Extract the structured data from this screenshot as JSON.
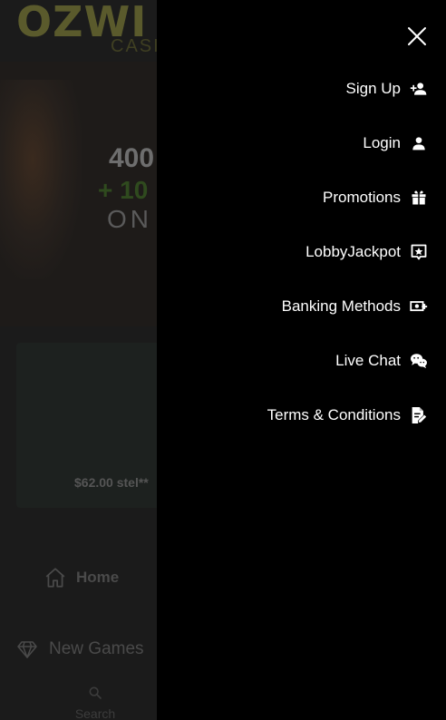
{
  "background": {
    "logo_text": "OZWI",
    "logo_sub": "CASI",
    "hero": {
      "amount": "400",
      "plus": "+ 10",
      "on": "ON"
    },
    "jackpot_card_text": "$62.00 stel**",
    "nav": {
      "home_label": "Home",
      "new_games_label": "New Games",
      "search_label": "Search"
    }
  },
  "drawer": {
    "menu_items": [
      {
        "label": "Sign Up",
        "icon": "person-add-icon"
      },
      {
        "label": "Login",
        "icon": "person-icon"
      },
      {
        "label": "Promotions",
        "icon": "gift-icon"
      },
      {
        "label": "LobbyJackpot",
        "icon": "star-badge-icon"
      },
      {
        "label": "Banking Methods",
        "icon": "money-add-icon"
      },
      {
        "label": "Live Chat",
        "icon": "chat-bubbles-icon"
      },
      {
        "label": "Terms & Conditions",
        "icon": "document-edit-icon"
      }
    ]
  },
  "colors": {
    "drawer_bg": "#000000",
    "text": "#ffffff",
    "dimmed_bg": "#1b1b1b"
  }
}
